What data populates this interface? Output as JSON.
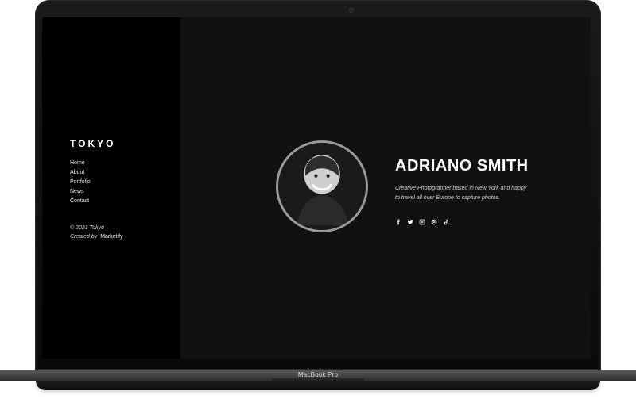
{
  "sidebar": {
    "logo": "TOKYO",
    "nav_items": [
      {
        "label": "Home"
      },
      {
        "label": "About"
      },
      {
        "label": "Portfolio"
      },
      {
        "label": "News"
      },
      {
        "label": "Contact"
      }
    ],
    "footer": {
      "copyright": "© 2021 Tokyo",
      "created_by_prefix": "Created by",
      "created_by_brand": "Marketify"
    }
  },
  "hero": {
    "name": "ADRIANO SMITH",
    "bio_line_1": "Creative Photographer based in New York and happy",
    "bio_line_2": "to travel all over Europe to capture photos.",
    "social_icons": [
      "facebook-icon",
      "twitter-icon",
      "instagram-icon",
      "dribbble-icon",
      "tiktok-icon"
    ]
  },
  "device": {
    "label": "MacBook Pro"
  },
  "colors": {
    "sidebar_bg": "#000000",
    "main_bg": "#111111",
    "text_primary": "#ffffff",
    "text_secondary": "#cfcfcf",
    "avatar_border": "#9a9a9a",
    "laptop_body": "#5b5b5b"
  }
}
